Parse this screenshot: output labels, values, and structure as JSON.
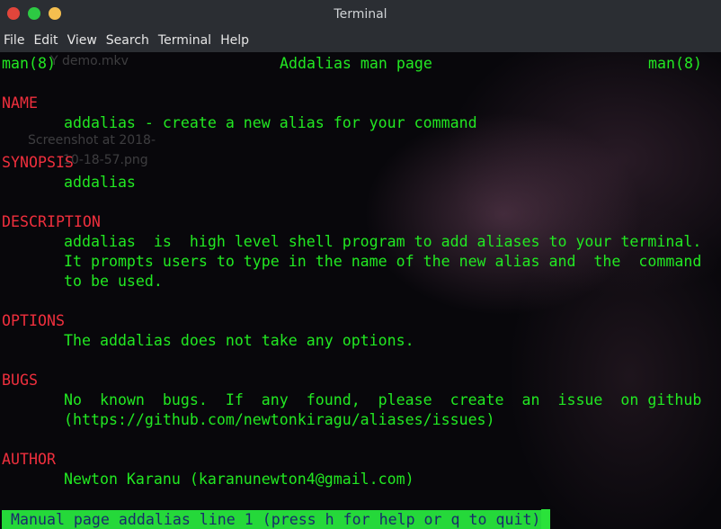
{
  "window": {
    "title": "Terminal",
    "menu": [
      "File",
      "Edit",
      "View",
      "Search",
      "Terminal",
      "Help"
    ]
  },
  "desktop_ghosts": {
    "file1": "Y demo.mkv",
    "file2_line1": "Screenshot at 2018-",
    "file2_line2": "10-18-57.png"
  },
  "man": {
    "header_left": "man(8)",
    "header_center": "Addalias man page",
    "header_right": "man(8)",
    "sections": {
      "name_heading": "NAME",
      "name_text": "addalias - create a new alias for your command",
      "synopsis_heading": "SYNOPSIS",
      "synopsis_text": "addalias",
      "description_heading": "DESCRIPTION",
      "description_line1": "addalias  is  high level shell program to add aliases to your terminal.",
      "description_line2": "It prompts users to type in the name of the new alias and  the  command",
      "description_line3": "to be used.",
      "options_heading": "OPTIONS",
      "options_text": "The addalias does not take any options.",
      "bugs_heading": "BUGS",
      "bugs_line1": "No  known  bugs.  If  any  found,  please  create  an  issue  on github",
      "bugs_line2": "(https://github.com/newtonkiragu/aliases/issues)",
      "author_heading": "AUTHOR",
      "author_text": "Newton Karanu (karanunewton4@gmail.com)"
    },
    "status": "Manual page addalias line 1 (press h for help or q to quit)"
  },
  "colors": {
    "text": "#22e822",
    "heading": "#ef2f3d",
    "status_bg": "#25d83a",
    "status_fg": "#1a2a6c"
  }
}
